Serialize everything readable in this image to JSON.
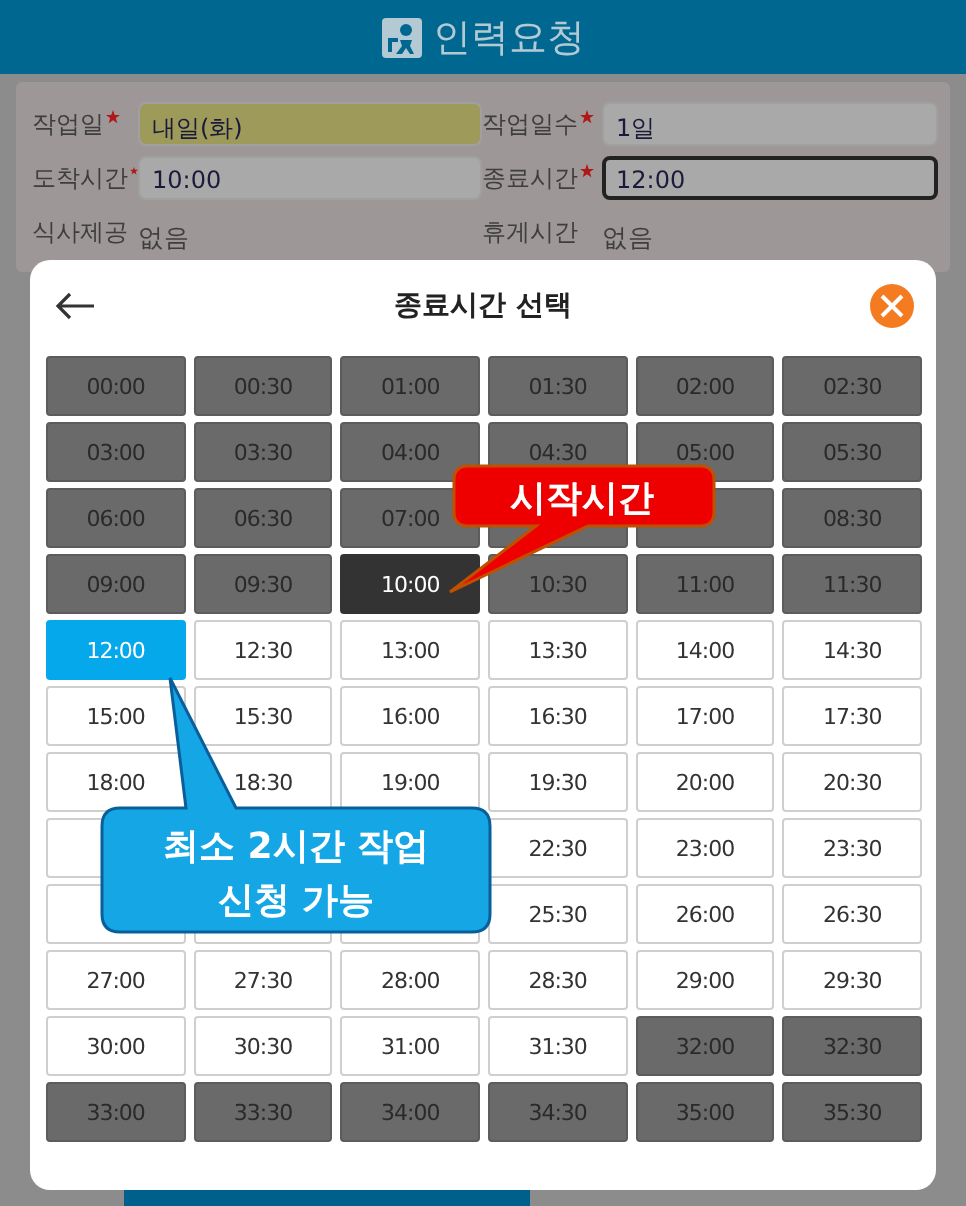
{
  "header": {
    "title": "인력요청"
  },
  "form": {
    "fields": [
      {
        "label": "작업일",
        "required": true,
        "value": "내일(화)",
        "highlighted": true,
        "focused": false
      },
      {
        "label": "작업일수",
        "required": true,
        "value": "1일",
        "highlighted": false,
        "focused": false
      },
      {
        "label": "도착시간",
        "required": true,
        "value": "10:00",
        "highlighted": false,
        "focused": false
      },
      {
        "label": "종료시간",
        "required": true,
        "value": "12:00",
        "highlighted": false,
        "focused": true
      }
    ],
    "info": [
      {
        "label": "식사제공",
        "value": "없음"
      },
      {
        "label": "휴게시간",
        "value": "없음"
      }
    ]
  },
  "dialog": {
    "title": "종료시간 선택",
    "cells": [
      {
        "label": "00:00",
        "kind": "disabled",
        "selected": false
      },
      {
        "label": "00:30",
        "kind": "disabled",
        "selected": false
      },
      {
        "label": "01:00",
        "kind": "disabled",
        "selected": false
      },
      {
        "label": "01:30",
        "kind": "disabled",
        "selected": false
      },
      {
        "label": "02:00",
        "kind": "disabled",
        "selected": false
      },
      {
        "label": "02:30",
        "kind": "disabled",
        "selected": false
      },
      {
        "label": "03:00",
        "kind": "disabled",
        "selected": false
      },
      {
        "label": "03:30",
        "kind": "disabled",
        "selected": false
      },
      {
        "label": "04:00",
        "kind": "disabled",
        "selected": false
      },
      {
        "label": "04:30",
        "kind": "disabled",
        "selected": false
      },
      {
        "label": "05:00",
        "kind": "disabled",
        "selected": false
      },
      {
        "label": "05:30",
        "kind": "disabled",
        "selected": false
      },
      {
        "label": "06:00",
        "kind": "disabled",
        "selected": false
      },
      {
        "label": "06:30",
        "kind": "disabled",
        "selected": false
      },
      {
        "label": "07:00",
        "kind": "disabled",
        "selected": false
      },
      {
        "kind": "disabled",
        "selected": false
      },
      {
        "kind": "disabled",
        "selected": false
      },
      {
        "label": "08:30",
        "kind": "disabled",
        "selected": false
      },
      {
        "label": "09:00",
        "kind": "disabled",
        "selected": false
      },
      {
        "label": "09:30",
        "kind": "disabled",
        "selected": false
      },
      {
        "label": "10:00",
        "kind": "start",
        "selected": false
      },
      {
        "label": "10:30",
        "kind": "disabled",
        "selected": false
      },
      {
        "label": "11:00",
        "kind": "disabled",
        "selected": false
      },
      {
        "label": "11:30",
        "kind": "disabled",
        "selected": false
      },
      {
        "label": "12:00",
        "kind": "open",
        "selected": true
      },
      {
        "label": "12:30",
        "kind": "open",
        "selected": false
      },
      {
        "label": "13:00",
        "kind": "open",
        "selected": false
      },
      {
        "label": "13:30",
        "kind": "open",
        "selected": false
      },
      {
        "label": "14:00",
        "kind": "open",
        "selected": false
      },
      {
        "label": "14:30",
        "kind": "open",
        "selected": false
      },
      {
        "label": "15:00",
        "kind": "open",
        "selected": false
      },
      {
        "label": "15:30",
        "kind": "open",
        "selected": false
      },
      {
        "label": "16:00",
        "kind": "open",
        "selected": false
      },
      {
        "label": "16:30",
        "kind": "open",
        "selected": false
      },
      {
        "label": "17:00",
        "kind": "open",
        "selected": false
      },
      {
        "label": "17:30",
        "kind": "open",
        "selected": false
      },
      {
        "label": "18:00",
        "kind": "open",
        "selected": false
      },
      {
        "label": "18:30",
        "kind": "open",
        "selected": false
      },
      {
        "label": "19:00",
        "kind": "open",
        "selected": false
      },
      {
        "label": "19:30",
        "kind": "open",
        "selected": false
      },
      {
        "label": "20:00",
        "kind": "open",
        "selected": false
      },
      {
        "label": "20:30",
        "kind": "open",
        "selected": false
      },
      {
        "kind": "open",
        "selected": false
      },
      {
        "kind": "covered"
      },
      {
        "kind": "covered"
      },
      {
        "label": "22:30",
        "kind": "open",
        "selected": false
      },
      {
        "label": "23:00",
        "kind": "open",
        "selected": false
      },
      {
        "label": "23:30",
        "kind": "open",
        "selected": false
      },
      {
        "kind": "open",
        "selected": false
      },
      {
        "kind": "open",
        "selected": false
      },
      {
        "kind": "open",
        "selected": false
      },
      {
        "label": "25:30",
        "kind": "open",
        "selected": false
      },
      {
        "label": "26:00",
        "kind": "open",
        "selected": false
      },
      {
        "label": "26:30",
        "kind": "open",
        "selected": false
      },
      {
        "label": "27:00",
        "kind": "open",
        "selected": false
      },
      {
        "label": "27:30",
        "kind": "open",
        "selected": false
      },
      {
        "label": "28:00",
        "kind": "open",
        "selected": false
      },
      {
        "label": "28:30",
        "kind": "open",
        "selected": false
      },
      {
        "label": "29:00",
        "kind": "open",
        "selected": false
      },
      {
        "label": "29:30",
        "kind": "open",
        "selected": false
      },
      {
        "label": "30:00",
        "kind": "open",
        "selected": false
      },
      {
        "label": "30:30",
        "kind": "open",
        "selected": false
      },
      {
        "label": "31:00",
        "kind": "open",
        "selected": false
      },
      {
        "label": "31:30",
        "kind": "open",
        "selected": false
      },
      {
        "label": "32:00",
        "kind": "disabled",
        "selected": false
      },
      {
        "label": "32:30",
        "kind": "disabled",
        "selected": false
      },
      {
        "label": "33:00",
        "kind": "disabled",
        "selected": false
      },
      {
        "label": "33:30",
        "kind": "disabled",
        "selected": false
      },
      {
        "label": "34:00",
        "kind": "disabled",
        "selected": false
      },
      {
        "label": "34:30",
        "kind": "disabled",
        "selected": false
      },
      {
        "label": "35:00",
        "kind": "disabled",
        "selected": false
      },
      {
        "label": "35:30",
        "kind": "disabled",
        "selected": false
      }
    ]
  },
  "callouts": [
    {
      "kind": "start",
      "lines": [
        "시작시간"
      ]
    },
    {
      "kind": "minimum",
      "lines": [
        "최소 2시간 작업",
        "신청 가능"
      ]
    }
  ]
}
